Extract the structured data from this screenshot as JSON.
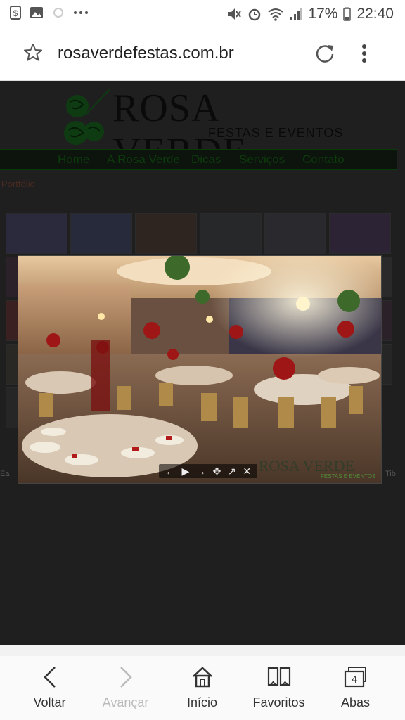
{
  "status_bar": {
    "battery": "17%",
    "time": "22:40",
    "left_icons": [
      "dollar-icon",
      "image-icon",
      "sync-icon",
      "more-icon"
    ],
    "right_icons": [
      "mute-icon",
      "alarm-icon",
      "wifi-icon",
      "signal-icon",
      "battery-icon"
    ]
  },
  "browser": {
    "url": "rosaverdefestas.com.br"
  },
  "site": {
    "logo_title": "ROSA VERDE",
    "logo_subtitle": "FESTAS E EVENTOS",
    "nav": [
      "Home",
      "A Rosa Verde",
      "Dicas",
      "Serviços",
      "Contato"
    ],
    "breadcrumb": "Portfólio"
  },
  "lightbox": {
    "controls": [
      "←",
      "▶",
      "→",
      "✥",
      "↗",
      "✕"
    ],
    "watermark": "ROSA VERDE",
    "watermark_sub": "FESTAS E EVENTOS"
  },
  "side_text": {
    "left": "Ea",
    "right": "Tib"
  },
  "bottom_nav": [
    {
      "label": "Voltar",
      "icon": "back-chevron-icon",
      "enabled": true
    },
    {
      "label": "Avançar",
      "icon": "forward-chevron-icon",
      "enabled": false
    },
    {
      "label": "Início",
      "icon": "home-icon",
      "enabled": true
    },
    {
      "label": "Favoritos",
      "icon": "bookmarks-icon",
      "enabled": true
    },
    {
      "label": "Abas",
      "icon": "tabs-icon",
      "enabled": true,
      "tab_count": "4"
    }
  ],
  "colors": {
    "page_bg": "#1f1f1f",
    "nav_text": "#0c3b0c",
    "logo_green": "#0f3b12"
  }
}
